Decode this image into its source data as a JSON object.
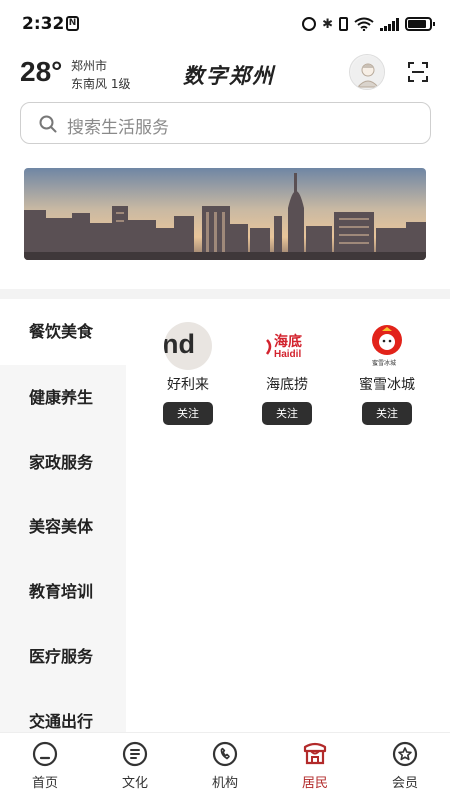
{
  "status_bar": {
    "time": "2:32",
    "nfc_label": "N",
    "bluetooth_glyph": "✱"
  },
  "weather": {
    "temperature": "28°",
    "city": "郑州市",
    "wind": "东南风  1级"
  },
  "app": {
    "logo_text": "数字郑州"
  },
  "search": {
    "placeholder": "搜索生活服务"
  },
  "categories": [
    {
      "label": "餐饮美食",
      "active": true
    },
    {
      "label": "健康养生",
      "active": false
    },
    {
      "label": "家政服务",
      "active": false
    },
    {
      "label": "美容美体",
      "active": false
    },
    {
      "label": "教育培训",
      "active": false
    },
    {
      "label": "医疗服务",
      "active": false
    },
    {
      "label": "交通出行",
      "active": false
    }
  ],
  "brands": [
    {
      "name": "好利来",
      "logo_text": "nd",
      "follow_label": "关注"
    },
    {
      "name": "海底捞",
      "logo_text": "海底",
      "logo_subtext": "Haidil",
      "follow_label": "关注"
    },
    {
      "name": "蜜雪冰城",
      "logo_subtext": "蜜雪冰城",
      "follow_label": "关注"
    }
  ],
  "tabs": [
    {
      "label": "首页",
      "icon": "home-icon",
      "active": false
    },
    {
      "label": "文化",
      "icon": "culture-icon",
      "active": false
    },
    {
      "label": "机构",
      "icon": "phone-icon",
      "active": false
    },
    {
      "label": "居民",
      "icon": "resident-icon",
      "active": true
    },
    {
      "label": "会员",
      "icon": "member-star-icon",
      "active": false
    }
  ],
  "colors": {
    "accent": "#b22a2a",
    "follow_button": "#2f2f2f",
    "category_bg": "#f6f6f6"
  }
}
